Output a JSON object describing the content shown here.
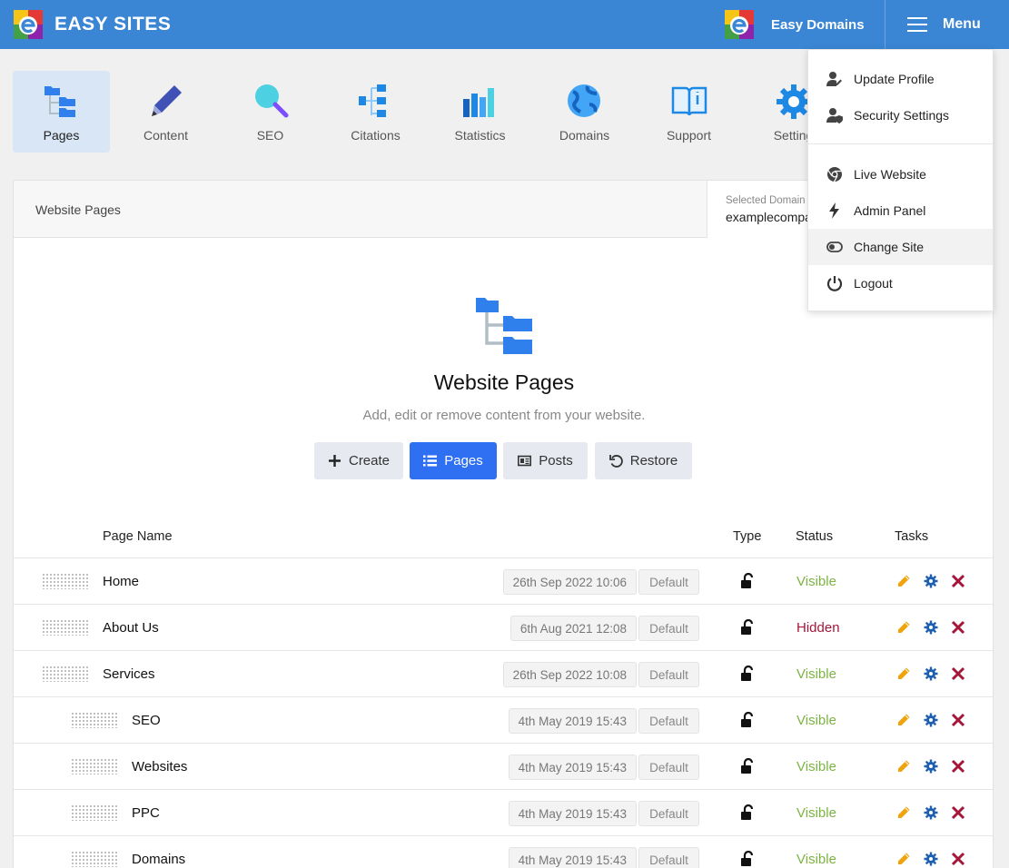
{
  "app": {
    "brand": "EASY SITES",
    "domains_link": "Easy Domains",
    "menu_label": "Menu"
  },
  "modules": [
    {
      "label": "Pages",
      "icon": "folder-tree-icon",
      "active": true
    },
    {
      "label": "Content",
      "icon": "pencil-icon",
      "active": false
    },
    {
      "label": "SEO",
      "icon": "magnifier-icon",
      "active": false
    },
    {
      "label": "Citations",
      "icon": "hierarchy-icon",
      "active": false
    },
    {
      "label": "Statistics",
      "icon": "bar-chart-icon",
      "active": false
    },
    {
      "label": "Domains",
      "icon": "globe-icon",
      "active": false
    },
    {
      "label": "Support",
      "icon": "book-icon",
      "active": false
    },
    {
      "label": "Setting",
      "icon": "gear-icon",
      "active": false
    }
  ],
  "panel": {
    "title": "Website Pages",
    "domain_caption": "Selected Domain",
    "domain_value": "examplecompa"
  },
  "hero": {
    "title": "Website Pages",
    "subtitle": "Add, edit or remove content from your website."
  },
  "actions": {
    "create": "Create",
    "pages": "Pages",
    "posts": "Posts",
    "restore": "Restore"
  },
  "table": {
    "headers": {
      "name": "Page Name",
      "type": "Type",
      "status": "Status",
      "tasks": "Tasks"
    },
    "rows": [
      {
        "name": "Home",
        "date": "26th Sep 2022 10:06",
        "template": "Default",
        "status": "Visible",
        "indent": 0
      },
      {
        "name": "About Us",
        "date": "6th Aug 2021 12:08",
        "template": "Default",
        "status": "Hidden",
        "indent": 0
      },
      {
        "name": "Services",
        "date": "26th Sep 2022 10:08",
        "template": "Default",
        "status": "Visible",
        "indent": 0
      },
      {
        "name": "SEO",
        "date": "4th May 2019 15:43",
        "template": "Default",
        "status": "Visible",
        "indent": 1
      },
      {
        "name": "Websites",
        "date": "4th May 2019 15:43",
        "template": "Default",
        "status": "Visible",
        "indent": 1
      },
      {
        "name": "PPC",
        "date": "4th May 2019 15:43",
        "template": "Default",
        "status": "Visible",
        "indent": 1
      },
      {
        "name": "Domains",
        "date": "4th May 2019 15:43",
        "template": "Default",
        "status": "Visible",
        "indent": 1
      }
    ]
  },
  "dropdown": {
    "items": [
      {
        "label": "Update Profile",
        "icon": "user-edit-icon"
      },
      {
        "label": "Security Settings",
        "icon": "user-shield-icon"
      },
      {
        "label": "Live Website",
        "icon": "browser-icon"
      },
      {
        "label": "Admin Panel",
        "icon": "lightning-icon"
      },
      {
        "label": "Change Site",
        "icon": "toggle-icon"
      },
      {
        "label": "Logout",
        "icon": "power-icon"
      }
    ]
  },
  "colors": {
    "topbar": "#3a86d4",
    "primary_button": "#2f6ff2",
    "visible": "#7cb342",
    "hidden": "#a5163a",
    "edit": "#f0a30a",
    "gear": "#1f5fb0",
    "delete": "#a5163a"
  }
}
